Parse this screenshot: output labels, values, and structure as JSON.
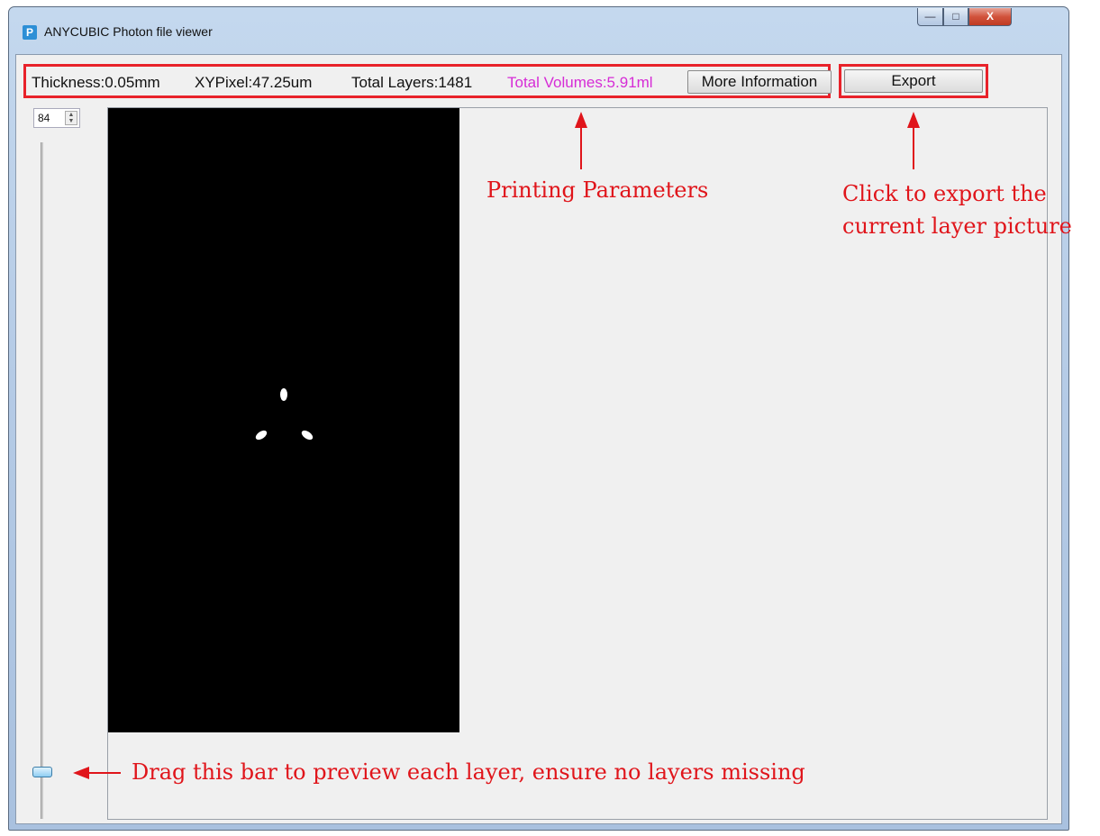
{
  "window": {
    "title": "ANYCUBIC Photon file viewer",
    "icon_letter": "P",
    "controls": {
      "minimize": "—",
      "maximize": "□",
      "close": "X"
    }
  },
  "info": {
    "thickness": "Thickness:0.05mm",
    "xypixel": "XYPixel:47.25um",
    "total_layers": "Total Layers:1481",
    "total_volumes": "Total Volumes:5.91ml",
    "more_button": "More Information"
  },
  "export_button": "Export",
  "layer_spin": {
    "value": "84",
    "arrow_up": "▲",
    "arrow_down": "▼"
  },
  "annotations": {
    "printing_parameters": "Printing Parameters",
    "export_line1": "Click to export the",
    "export_line2": "current layer picture",
    "drag_note": "Drag this bar to preview each layer, ensure no layers missing"
  },
  "colors": {
    "annotation_red": "#e0151b",
    "volume_magenta": "#d62cd6",
    "layer_background": "#000000"
  }
}
